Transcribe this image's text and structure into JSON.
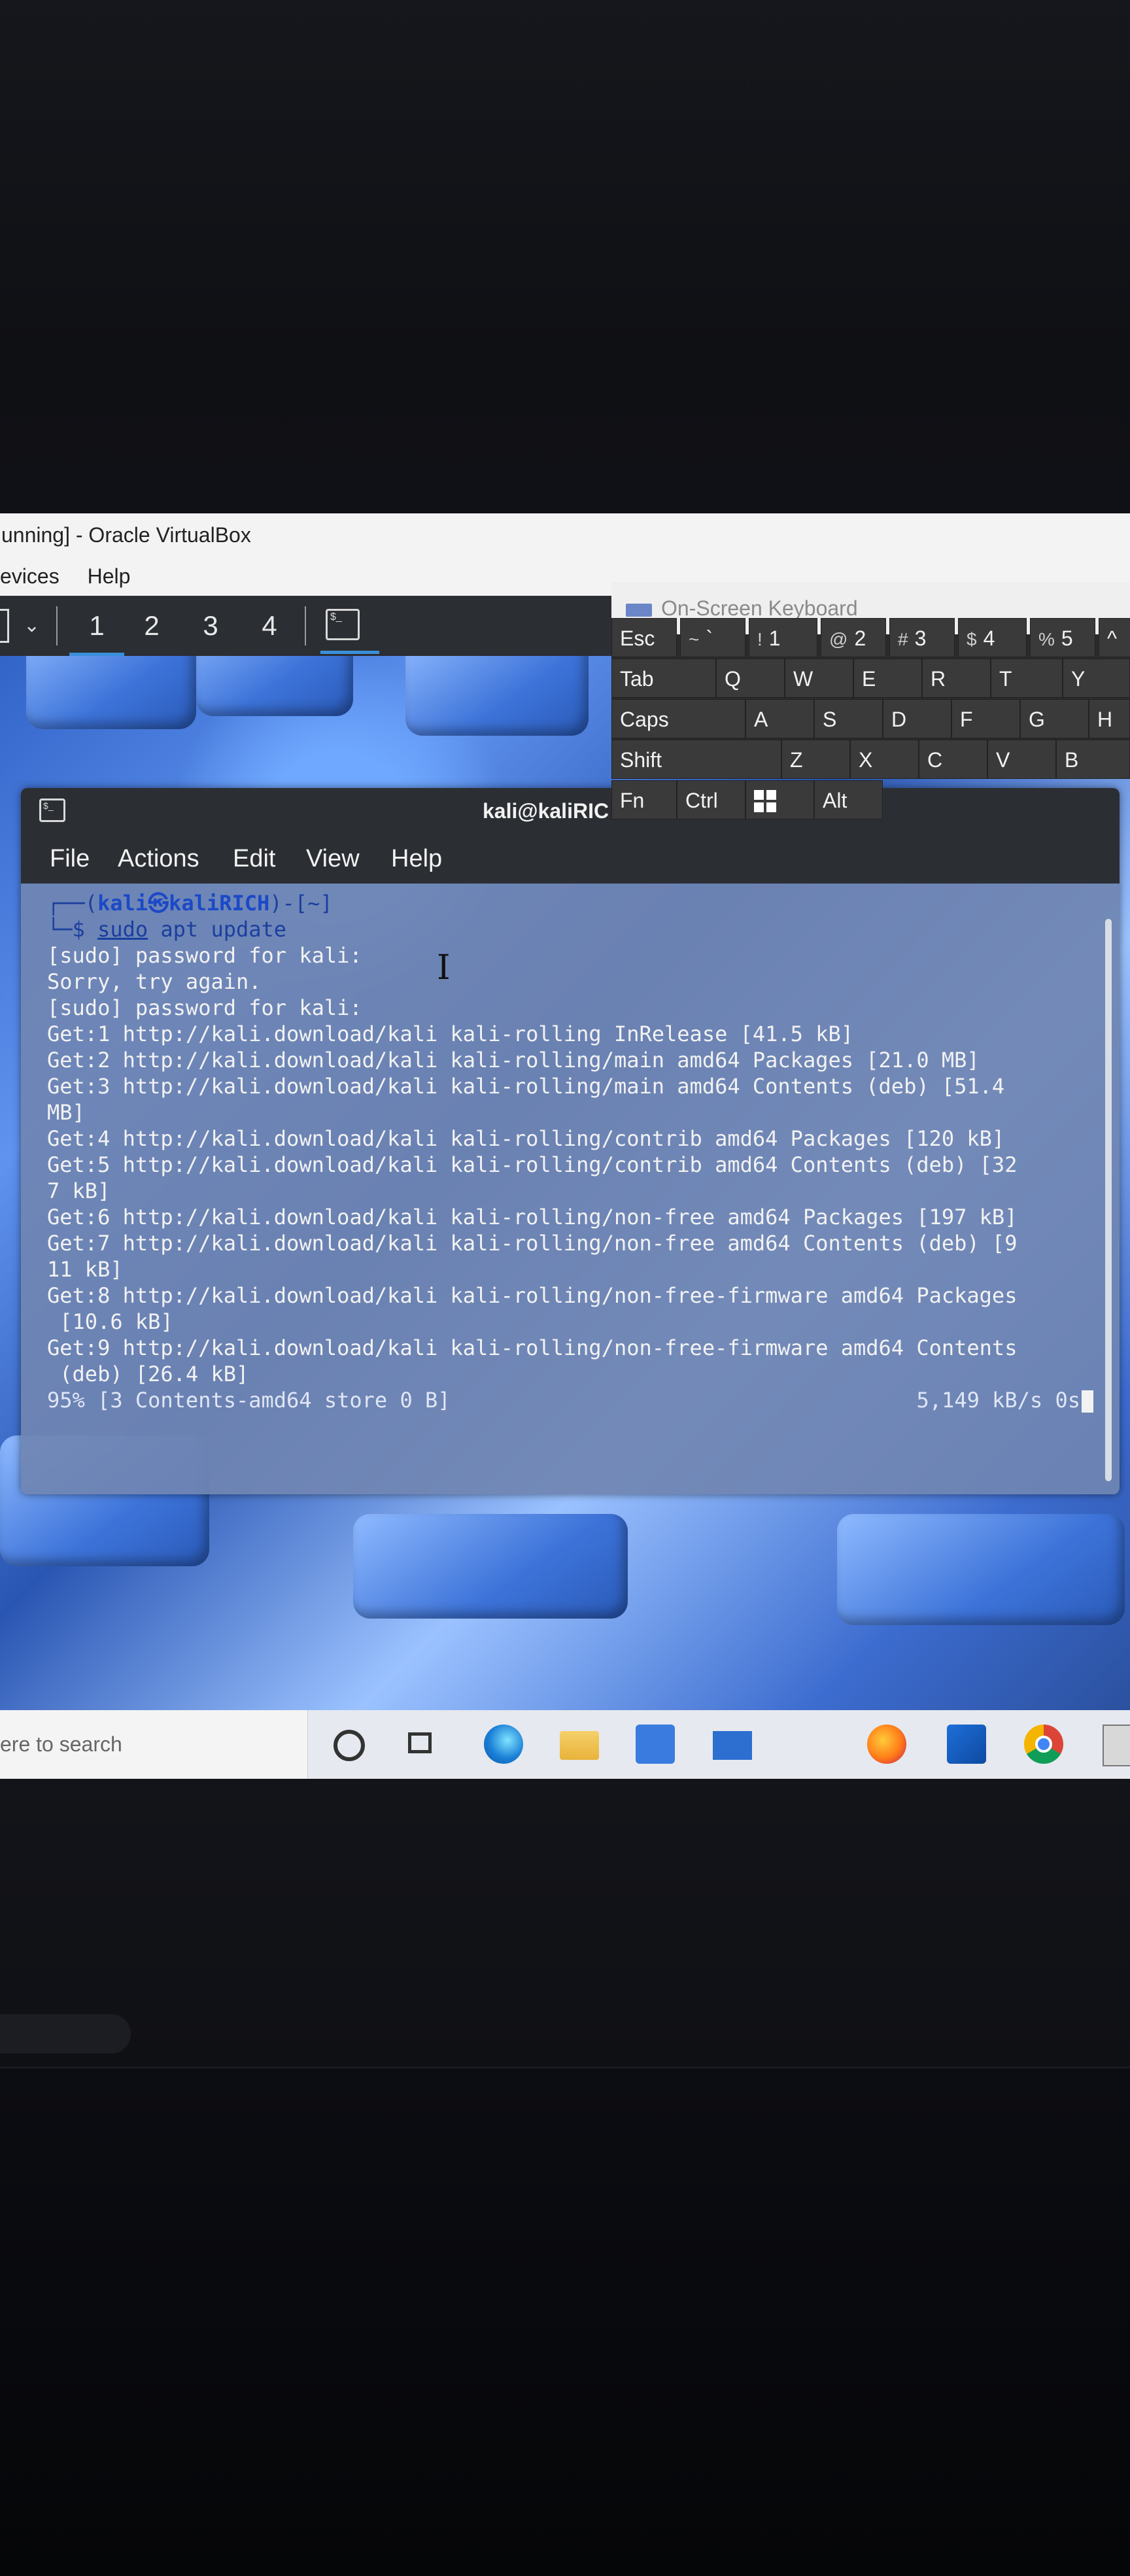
{
  "virtualbox": {
    "title": "unning] - Oracle VirtualBox",
    "menu": [
      "evices",
      "Help"
    ]
  },
  "kali_panel": {
    "workspaces": [
      "1",
      "2",
      "3",
      "4"
    ],
    "terminal_launcher_glyph": "$_"
  },
  "osk": {
    "title": "On-Screen Keyboard",
    "row1": [
      {
        "sup": "",
        "label": "Esc"
      },
      {
        "sup": "~",
        "label": "`"
      },
      {
        "sup": "!",
        "label": "1"
      },
      {
        "sup": "@",
        "label": "2"
      },
      {
        "sup": "#",
        "label": "3"
      },
      {
        "sup": "$",
        "label": "4"
      },
      {
        "sup": "%",
        "label": "5"
      },
      {
        "sup": "",
        "label": "^"
      }
    ],
    "row2": [
      "Tab",
      "Q",
      "W",
      "E",
      "R",
      "T",
      "Y"
    ],
    "row3": [
      "Caps",
      "A",
      "S",
      "D",
      "F",
      "G",
      "H"
    ],
    "row4": [
      "Shift",
      "Z",
      "X",
      "C",
      "V",
      "B"
    ],
    "row5": [
      "Fn",
      "Ctrl",
      "",
      "Alt"
    ],
    "active_key_color": "#3aa0e0"
  },
  "terminal": {
    "title": "kali@kaliRIC",
    "menu": [
      "File",
      "Actions",
      "Edit",
      "View",
      "Help"
    ],
    "prompt": {
      "frame_top": "┌──(",
      "user": "kali㉿kaliRICH",
      "dir": ")-[~]",
      "frame_bottom": "└─$ ",
      "cmd_sudo": "sudo",
      "cmd_rest": " apt update"
    },
    "lines": [
      "[sudo] password for kali:",
      "Sorry, try again.",
      "[sudo] password for kali:",
      "Get:1 http://kali.download/kali kali-rolling InRelease [41.5 kB]",
      "Get:2 http://kali.download/kali kali-rolling/main amd64 Packages [21.0 MB]",
      "Get:3 http://kali.download/kali kali-rolling/main amd64 Contents (deb) [51.4",
      "MB]",
      "Get:4 http://kali.download/kali kali-rolling/contrib amd64 Packages [120 kB]",
      "Get:5 http://kali.download/kali kali-rolling/contrib amd64 Contents (deb) [32",
      "7 kB]",
      "Get:6 http://kali.download/kali kali-rolling/non-free amd64 Packages [197 kB]",
      "Get:7 http://kali.download/kali kali-rolling/non-free amd64 Contents (deb) [9",
      "11 kB]",
      "Get:8 http://kali.download/kali kali-rolling/non-free-firmware amd64 Packages",
      " [10.6 kB]",
      "Get:9 http://kali.download/kali kali-rolling/non-free-firmware amd64 Contents",
      " (deb) [26.4 kB]"
    ],
    "progress_left": "95% [3 Contents-amd64 store 0 B]",
    "progress_right": "5,149 kB/s 0s"
  },
  "taskbar": {
    "search_text": "ere to search"
  }
}
